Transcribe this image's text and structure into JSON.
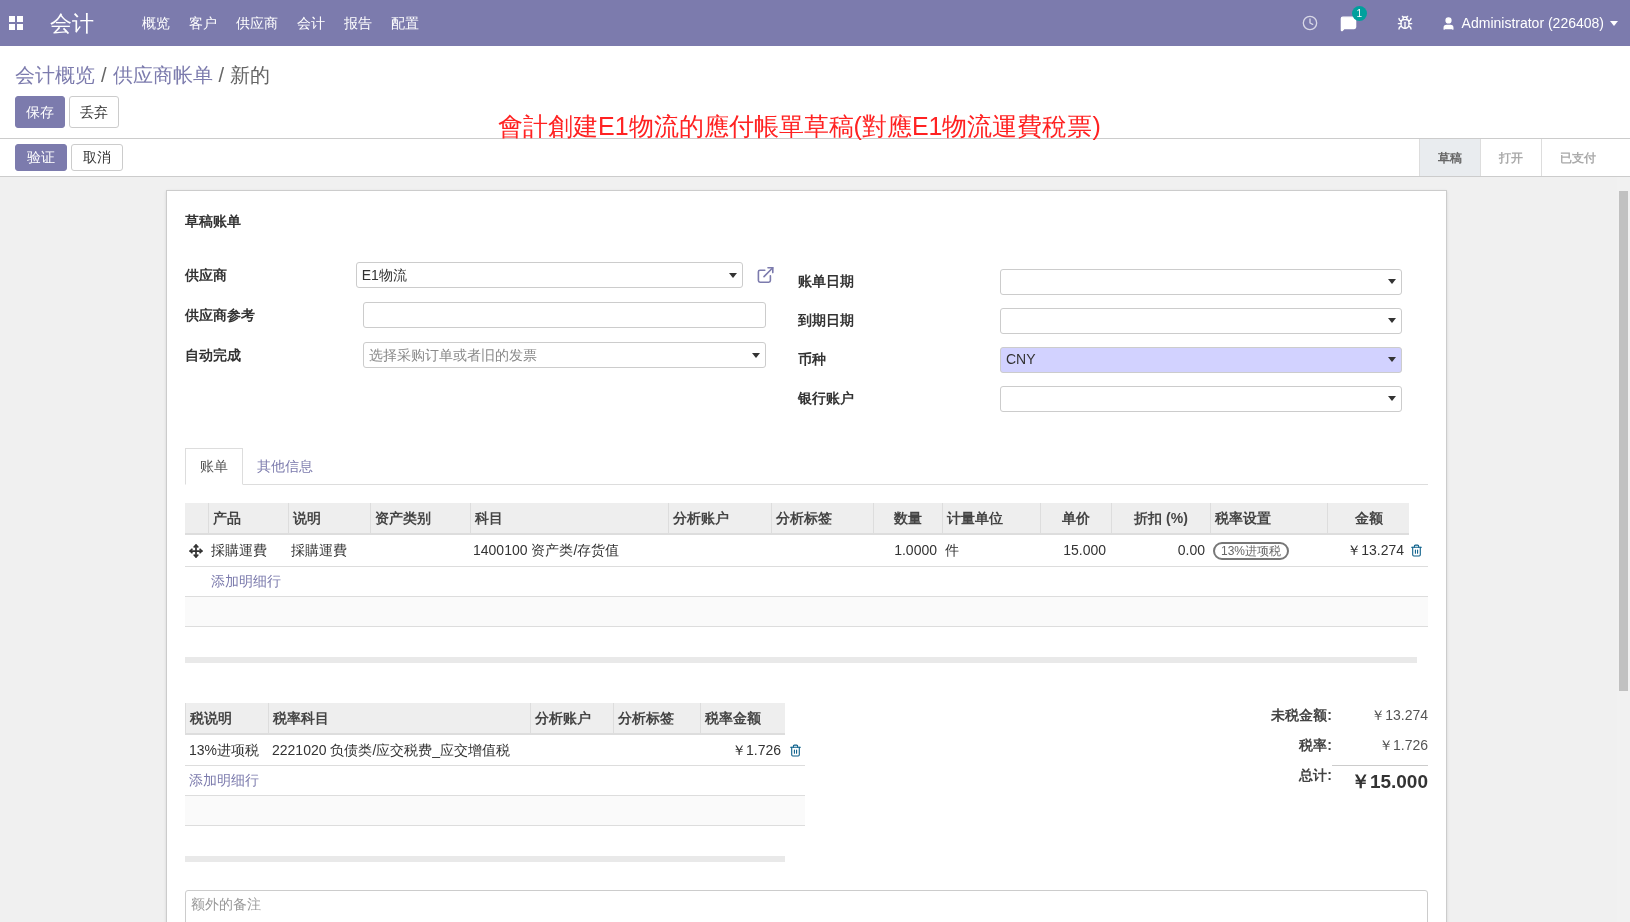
{
  "navbar": {
    "app_name": "会计",
    "menu": [
      "概览",
      "客户",
      "供应商",
      "会计",
      "报告",
      "配置"
    ],
    "chat_badge": "1",
    "user": "Administrator (226408)"
  },
  "breadcrumb": [
    {
      "label": "会计概览",
      "link": true
    },
    {
      "separator": "/",
      "label": "供应商帐单",
      "link": true
    },
    {
      "separator": "/",
      "label": "新的",
      "link": false
    }
  ],
  "form_buttons": [
    {
      "label": "保存",
      "primary": true
    },
    {
      "label": "丢弃",
      "primary": false
    }
  ],
  "annotation": "會計創建E1物流的應付帳單草稿(對應E1物流運費稅票)",
  "action_buttons": [
    {
      "label": "验证",
      "primary": true
    },
    {
      "label": "取消",
      "primary": false
    }
  ],
  "status_steps": [
    {
      "label": "草稿",
      "selected": true
    },
    {
      "label": "打开",
      "selected": false
    },
    {
      "label": "已支付",
      "selected": false
    }
  ],
  "sheet": {
    "title": "草稿账单",
    "left_fields": [
      {
        "label": "供应商",
        "kind": "select",
        "value": "E1物流",
        "highlighted": false,
        "external_link": true
      },
      {
        "label": "供应商参考",
        "kind": "input",
        "highlighted": false,
        "external_link": false
      },
      {
        "label": "自动完成",
        "kind": "select",
        "placeholder": "选择采购订单或者旧的发票",
        "highlighted": false,
        "external_link": false
      }
    ],
    "right_fields": [
      {
        "label": "账单日期",
        "kind": "select",
        "highlighted": false
      },
      {
        "label": "到期日期",
        "kind": "select",
        "highlighted": false
      },
      {
        "label": "币种",
        "kind": "select",
        "value": "CNY",
        "highlighted": true
      },
      {
        "label": "银行账户",
        "kind": "select",
        "highlighted": false
      }
    ],
    "tabs": [
      {
        "label": "账单",
        "selected": true
      },
      {
        "label": "其他信息",
        "selected": false
      }
    ],
    "lines": {
      "columns": [
        "产品",
        "说明",
        "资产类别",
        "科目",
        "分析账户",
        "分析标签",
        "数量",
        "计量单位",
        "单价",
        "折扣 (%)",
        "税率设置",
        "金额"
      ],
      "rows": [
        {
          "cells": [
            "採購運費",
            "採購運費",
            "",
            "1400100 资产类/存货值",
            "",
            "",
            "1.0000",
            "件",
            "15.000",
            "0.00",
            "13%进项税",
            "￥13.274"
          ]
        }
      ],
      "add_line": "添加明细行"
    },
    "taxes": {
      "columns": [
        "税说明",
        "税率科目",
        "分析账户",
        "分析标签",
        "税率金额"
      ],
      "rows": [
        {
          "cells": [
            "13%进项税",
            "2221020 负债类/应交税费_应交增值税",
            "",
            "",
            "￥1.726"
          ]
        }
      ],
      "add_line": "添加明细行"
    },
    "totals": [
      {
        "label": "未税金额:",
        "value": "￥13.274",
        "grand": false
      },
      {
        "label": "税率:",
        "value": "￥1.726",
        "grand": false
      },
      {
        "label": "总计:",
        "value": "￥15.000",
        "grand": true
      }
    ],
    "notes": {
      "placeholder": "额外的备注"
    }
  }
}
